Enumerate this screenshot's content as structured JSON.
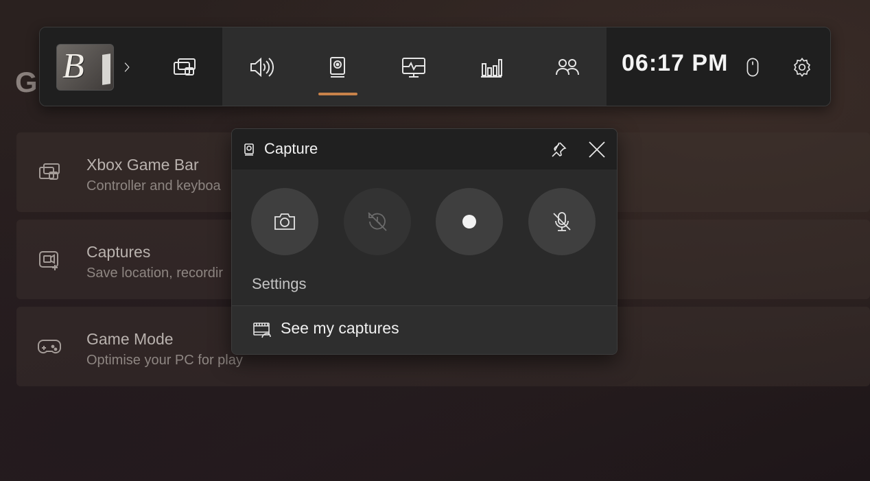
{
  "background_page": {
    "title_fragment": "G",
    "items": [
      {
        "title": "Xbox Game Bar",
        "subtitle": "Controller and keyboa"
      },
      {
        "title": "Captures",
        "subtitle": "Save location, recordir"
      },
      {
        "title": "Game Mode",
        "subtitle": "Optimise your PC for play"
      }
    ]
  },
  "gamebar": {
    "avatar_letter": "B",
    "clock": "06:17 PM",
    "active_widget": "capture",
    "accent_color": "#c8824a",
    "buttons": [
      "expand-chevron",
      "widget-menu",
      "audio",
      "capture",
      "performance",
      "resources",
      "social",
      "mouse",
      "settings"
    ]
  },
  "capture_widget": {
    "title": "Capture",
    "settings_label": "Settings",
    "see_captures_label": "See my captures",
    "buttons": [
      {
        "name": "screenshot",
        "icon": "camera-icon",
        "enabled": true
      },
      {
        "name": "record-last",
        "icon": "history-off-icon",
        "enabled": false
      },
      {
        "name": "start-recording",
        "icon": "record-dot-icon",
        "enabled": true
      },
      {
        "name": "microphone",
        "icon": "mic-off-icon",
        "enabled": true
      }
    ]
  }
}
